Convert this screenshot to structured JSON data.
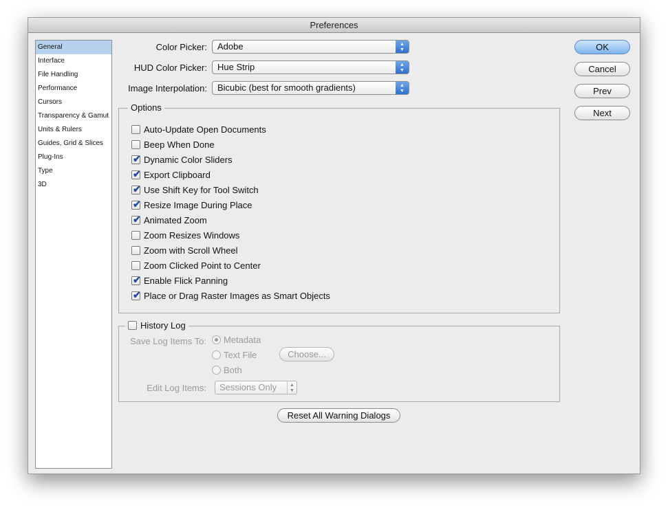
{
  "window": {
    "title": "Preferences"
  },
  "sidebar": {
    "items": [
      {
        "label": "General",
        "selected": true
      },
      {
        "label": "Interface"
      },
      {
        "label": "File Handling"
      },
      {
        "label": "Performance"
      },
      {
        "label": "Cursors"
      },
      {
        "label": "Transparency & Gamut"
      },
      {
        "label": "Units & Rulers"
      },
      {
        "label": "Guides, Grid & Slices"
      },
      {
        "label": "Plug-Ins"
      },
      {
        "label": "Type"
      },
      {
        "label": "3D"
      }
    ]
  },
  "general": {
    "color_picker": {
      "label": "Color Picker:",
      "value": "Adobe"
    },
    "hud_color_picker": {
      "label": "HUD Color Picker:",
      "value": "Hue Strip"
    },
    "image_interpolation": {
      "label": "Image Interpolation:",
      "value": "Bicubic (best for smooth gradients)"
    }
  },
  "options": {
    "title": "Options",
    "items": [
      {
        "label": "Auto-Update Open Documents",
        "checked": false
      },
      {
        "label": "Beep When Done",
        "checked": false
      },
      {
        "label": "Dynamic Color Sliders",
        "checked": true
      },
      {
        "label": "Export Clipboard",
        "checked": true
      },
      {
        "label": "Use Shift Key for Tool Switch",
        "checked": true
      },
      {
        "label": "Resize Image During Place",
        "checked": true
      },
      {
        "label": "Animated Zoom",
        "checked": true
      },
      {
        "label": "Zoom Resizes Windows",
        "checked": false
      },
      {
        "label": "Zoom with Scroll Wheel",
        "checked": false
      },
      {
        "label": "Zoom Clicked Point to Center",
        "checked": false
      },
      {
        "label": "Enable Flick Panning",
        "checked": true
      },
      {
        "label": "Place or Drag Raster Images as Smart Objects",
        "checked": true
      }
    ]
  },
  "history_log": {
    "title": "History Log",
    "checked": false,
    "save_log_label": "Save Log Items To:",
    "radio_options": [
      {
        "label": "Metadata",
        "selected": true
      },
      {
        "label": "Text File",
        "selected": false
      },
      {
        "label": "Both",
        "selected": false
      }
    ],
    "choose_label": "Choose...",
    "edit_log_label": "Edit Log Items:",
    "edit_log_value": "Sessions Only"
  },
  "reset_warnings_label": "Reset All Warning Dialogs",
  "buttons": {
    "ok": "OK",
    "cancel": "Cancel",
    "prev": "Prev",
    "next": "Next"
  },
  "glyphs": {
    "check": "✔",
    "popup_arrows": "▲▼"
  },
  "colors": {
    "selection": "#b7d2ee",
    "default_button": "#7fb4ee",
    "check": "#1d4aa8"
  }
}
